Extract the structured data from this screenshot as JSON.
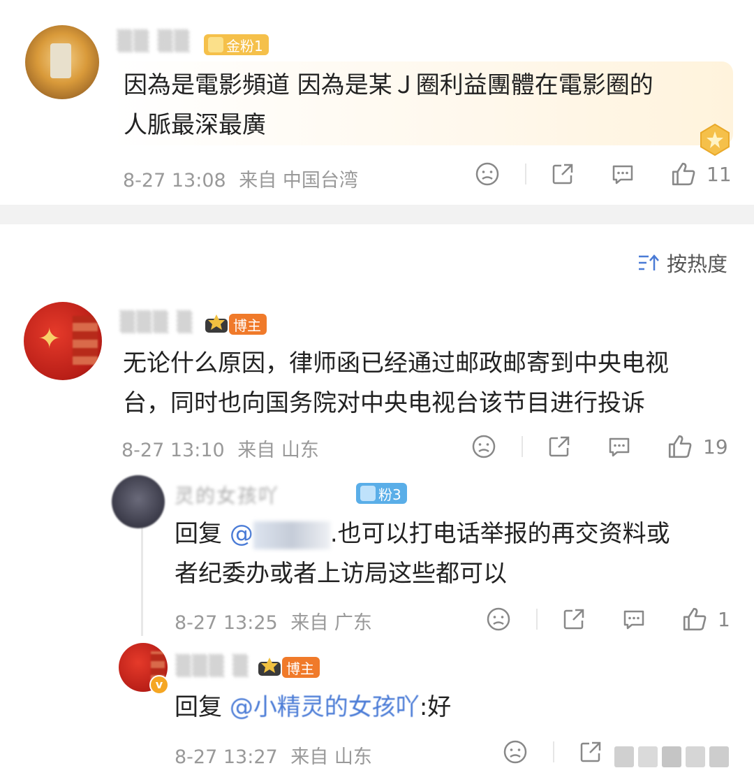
{
  "comments": [
    {
      "badge": "金粉1",
      "line1": "因為是電影頻道 因為是某Ｊ圈利益團體在電影圈的",
      "line2": "人脈最深最廣",
      "time": "8-27 13:08",
      "location": "来自 中国台湾",
      "likes": "11"
    },
    {
      "badge": "博主",
      "line1": "无论什么原因，律师函已经通过邮政邮寄到中央电视",
      "line2": "台，同时也向国务院对中央电视台该节目进行投诉",
      "time": "8-27 13:10",
      "location": "来自 山东",
      "likes": "19"
    }
  ],
  "sort": {
    "label": "按热度"
  },
  "replies": [
    {
      "name": "灵的女孩吖",
      "badge": "粉3",
      "prefix": "回复 ",
      "mention": "@",
      "line1_rest": ".也可以打电话举报的再交资料或",
      "line2": "者纪委办或者上访局这些都可以",
      "time": "8-27 13:25",
      "location": "来自 广东",
      "likes": "1"
    },
    {
      "badge": "博主",
      "prefix": "回复 ",
      "mention": "@小精灵的女孩吖",
      "suffix": ":好",
      "time": "8-27 13:27",
      "location": "来自 山东"
    }
  ],
  "colors": {
    "gold_badge": "#f5c04a",
    "blogger_badge": "#f07a2a",
    "fan_badge": "#5aaee8",
    "link": "#4a7bd6"
  }
}
